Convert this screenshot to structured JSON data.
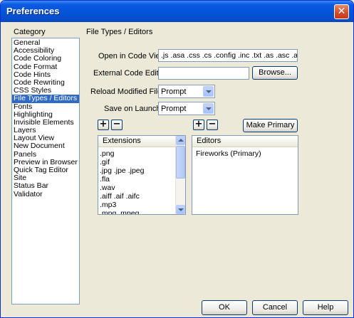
{
  "window": {
    "title": "Preferences",
    "close_glyph": "✕"
  },
  "category": {
    "label": "Category",
    "items": [
      "General",
      "Accessibility",
      "Code Coloring",
      "Code Format",
      "Code Hints",
      "Code Rewriting",
      "CSS Styles",
      "File Types / Editors",
      "Fonts",
      "Highlighting",
      "Invisible Elements",
      "Layers",
      "Layout View",
      "New Document",
      "Panels",
      "Preview in Browser",
      "Quick Tag Editor",
      "Site",
      "Status Bar",
      "Validator"
    ],
    "selected": "File Types / Editors"
  },
  "panel": {
    "title": "File Types / Editors",
    "open_in_code_view": {
      "label": "Open in Code View:",
      "value": ".js .asa .css .cs .config .inc .txt .as .asc .asr"
    },
    "external_code_editor": {
      "label": "External Code Editor:",
      "value": "",
      "browse_label": "Browse..."
    },
    "reload_modified_files": {
      "label": "Reload Modified Files:",
      "value": "Prompt"
    },
    "save_on_launch": {
      "label": "Save on Launch:",
      "value": "Prompt"
    },
    "plus_glyph": "+",
    "minus_glyph": "−",
    "make_primary_label": "Make Primary",
    "extensions": {
      "header": "Extensions",
      "items": [
        ".png",
        ".gif",
        ".jpg .jpe .jpeg",
        ".fla",
        ".wav",
        ".aiff .aif .aifc",
        ".mp3",
        ".mpg .mpeg"
      ]
    },
    "editors": {
      "header": "Editors",
      "items": [
        "Fireworks (Primary)"
      ]
    }
  },
  "footer": {
    "ok_label": "OK",
    "cancel_label": "Cancel",
    "help_label": "Help"
  }
}
